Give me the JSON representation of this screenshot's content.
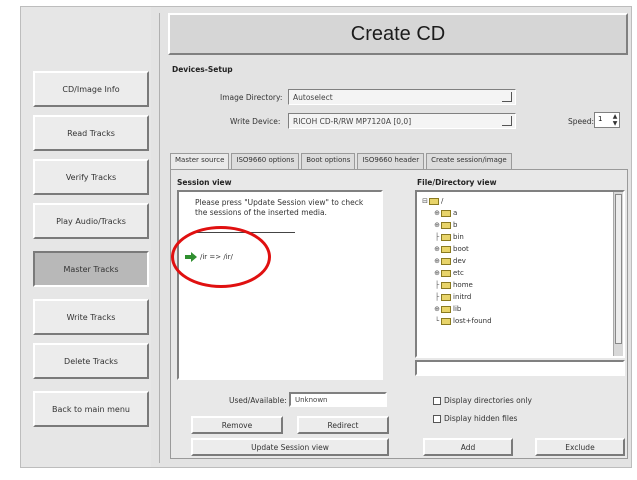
{
  "window": {
    "title": "Create CD"
  },
  "sidebar": {
    "items": [
      {
        "label": "CD/Image Info"
      },
      {
        "label": "Read Tracks"
      },
      {
        "label": "Verify Tracks"
      },
      {
        "label": "Play Audio/Tracks"
      },
      {
        "label": "Master Tracks",
        "active": true
      },
      {
        "label": "Write Tracks"
      },
      {
        "label": "Delete Tracks"
      },
      {
        "label": "Back to main menu"
      }
    ]
  },
  "devices": {
    "group_label": "Devices-Setup",
    "image_dir_label": "Image Directory:",
    "image_dir_value": "Autoselect",
    "write_device_label": "Write Device:",
    "write_device_value": "RICOH   CD-R/RW MP7120A  [0,0]",
    "speed_label": "Speed:",
    "speed_value": "1"
  },
  "tabs": [
    {
      "label": "Master source",
      "active": true
    },
    {
      "label": "ISO9660 options"
    },
    {
      "label": "Boot options"
    },
    {
      "label": "ISO9660 header"
    },
    {
      "label": "Create session/image"
    }
  ],
  "session": {
    "label": "Session view",
    "message": "Please press \"Update Session view\" to check the sessions of the inserted media.",
    "entry": "/ir => /ir/",
    "used_available_label": "Used/Available:",
    "used_available_value": "Unknown",
    "remove_label": "Remove",
    "redirect_label": "Redirect",
    "update_label": "Update Session view"
  },
  "filetree": {
    "label": "File/Directory view",
    "root": "/",
    "folders": [
      "a",
      "b",
      "bin",
      "boot",
      "dev",
      "etc",
      "home",
      "initrd",
      "lib",
      "lost+found"
    ],
    "display_dirs_only": "Display directories only",
    "display_hidden": "Display hidden files",
    "add_label": "Add",
    "exclude_label": "Exclude"
  },
  "colors": {
    "annotation_circle": "#e01010",
    "arrow": "#2f8f2f"
  }
}
